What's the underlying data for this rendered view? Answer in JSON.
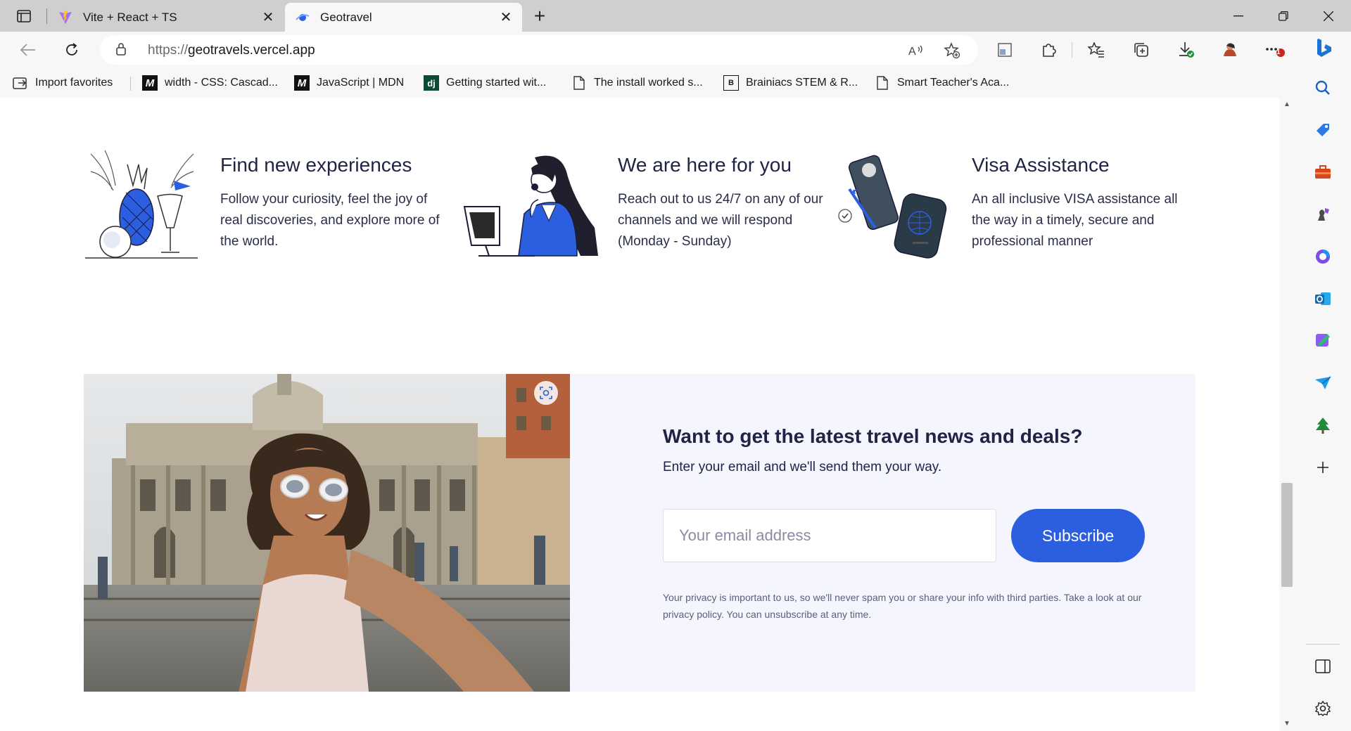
{
  "browser": {
    "tabs": [
      {
        "title": "Vite + React + TS",
        "active": false
      },
      {
        "title": "Geotravel",
        "active": true
      }
    ],
    "url_scheme": "https://",
    "url_host": "geotravels.vercel.app",
    "favorites": [
      {
        "label": "Import favorites",
        "icon": "import-icon"
      },
      {
        "label": "width - CSS: Cascad...",
        "icon": "mdn-icon"
      },
      {
        "label": "JavaScript | MDN",
        "icon": "mdn-icon"
      },
      {
        "label": "Getting started wit...",
        "icon": "django-icon"
      },
      {
        "label": "The install worked s...",
        "icon": "page-icon"
      },
      {
        "label": "Brainiacs STEM & R...",
        "icon": "brainiacs-icon"
      },
      {
        "label": "Smart Teacher's Aca...",
        "icon": "page-icon"
      }
    ],
    "notification_badge": "1"
  },
  "features": [
    {
      "title": "Find new experiences",
      "description": "Follow your curiosity, feel the joy of real discoveries, and explore more of the world.",
      "icon": "pineapple-cocktail-illustration"
    },
    {
      "title": "We are here for you",
      "description": "Reach out to us 24/7 on any of our channels and we will respond (Monday - Sunday)",
      "icon": "support-agent-illustration"
    },
    {
      "title": "Visa Assistance",
      "description": "An all inclusive VISA assistance all the way in a timely, secure and professional manner",
      "icon": "passport-illustration"
    }
  ],
  "newsletter": {
    "heading": "Want to get the latest travel news and deals?",
    "subheading": "Enter your email and we'll send them your way.",
    "email_placeholder": "Your email address",
    "email_value": "",
    "subscribe_label": "Subscribe",
    "privacy_text": "Your privacy is important to us, so we'll never spam you or share your info with third parties. Take a look at our privacy policy. You can unsubscribe at any time."
  },
  "colors": {
    "accent": "#2c5fe0",
    "heading": "#1f2346",
    "panel_bg": "#f4f5fd"
  }
}
